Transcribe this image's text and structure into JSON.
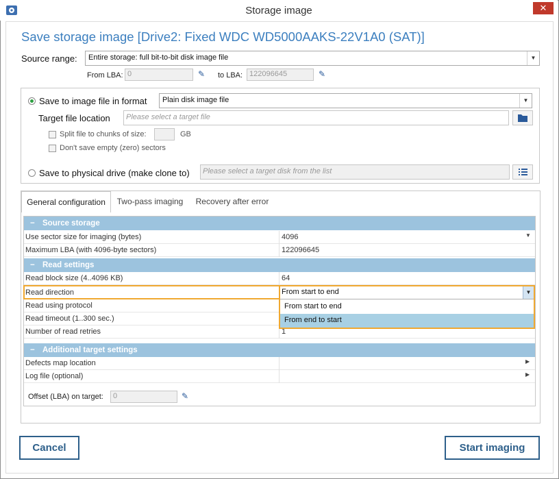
{
  "window": {
    "title": "Storage image",
    "close_glyph": "✕"
  },
  "heading": "Save storage image [Drive2: Fixed WDC WD5000AAKS-22V1A0 (SAT)]",
  "source_range": {
    "label": "Source range:",
    "value": "Entire storage: full bit-to-bit disk image file",
    "from_label": "From LBA:",
    "from_value": "0",
    "to_label": "to LBA:",
    "to_value": "122096645"
  },
  "image_file": {
    "radio_label": "Save to image file in format",
    "format_value": "Plain disk image file",
    "target_label": "Target file location",
    "target_placeholder": "Please select a target file",
    "split_label": "Split file to chunks of size:",
    "split_unit": "GB",
    "empty_label": "Don't save empty (zero) sectors"
  },
  "physical": {
    "radio_label": "Save to physical drive (make clone to)",
    "placeholder": "Please select a target disk from the list"
  },
  "tabs": [
    "General configuration",
    "Two-pass imaging",
    "Recovery after error"
  ],
  "sections": {
    "source": "Source storage",
    "read": "Read settings",
    "target": "Additional target settings"
  },
  "rows": {
    "sector_size": {
      "key": "Use sector size for imaging (bytes)",
      "value": "4096"
    },
    "max_lba": {
      "key": "Maximum LBA (with 4096-byte sectors)",
      "value": "122096645"
    },
    "block_size": {
      "key": "Read block size (4..4096 KB)",
      "value": "64"
    },
    "direction": {
      "key": "Read direction",
      "value": "From start to end"
    },
    "protocol": {
      "key": "Read using protocol",
      "value": ""
    },
    "timeout": {
      "key": "Read timeout (1..300 sec.)",
      "value": ""
    },
    "retries": {
      "key": "Number of read retries",
      "value": "1"
    },
    "defects": {
      "key": "Defects map location",
      "value": ""
    },
    "log": {
      "key": "Log file (optional)",
      "value": ""
    }
  },
  "dropdown_options": [
    "From start to end",
    "From end to start"
  ],
  "offset": {
    "label": "Offset (LBA) on target:",
    "value": "0"
  },
  "buttons": {
    "cancel": "Cancel",
    "start": "Start imaging"
  },
  "icons": {
    "minus": "−",
    "arrow_down": "▼",
    "arrow_right": "▶",
    "pen": "✎",
    "folder": "📂",
    "list": "☰"
  }
}
